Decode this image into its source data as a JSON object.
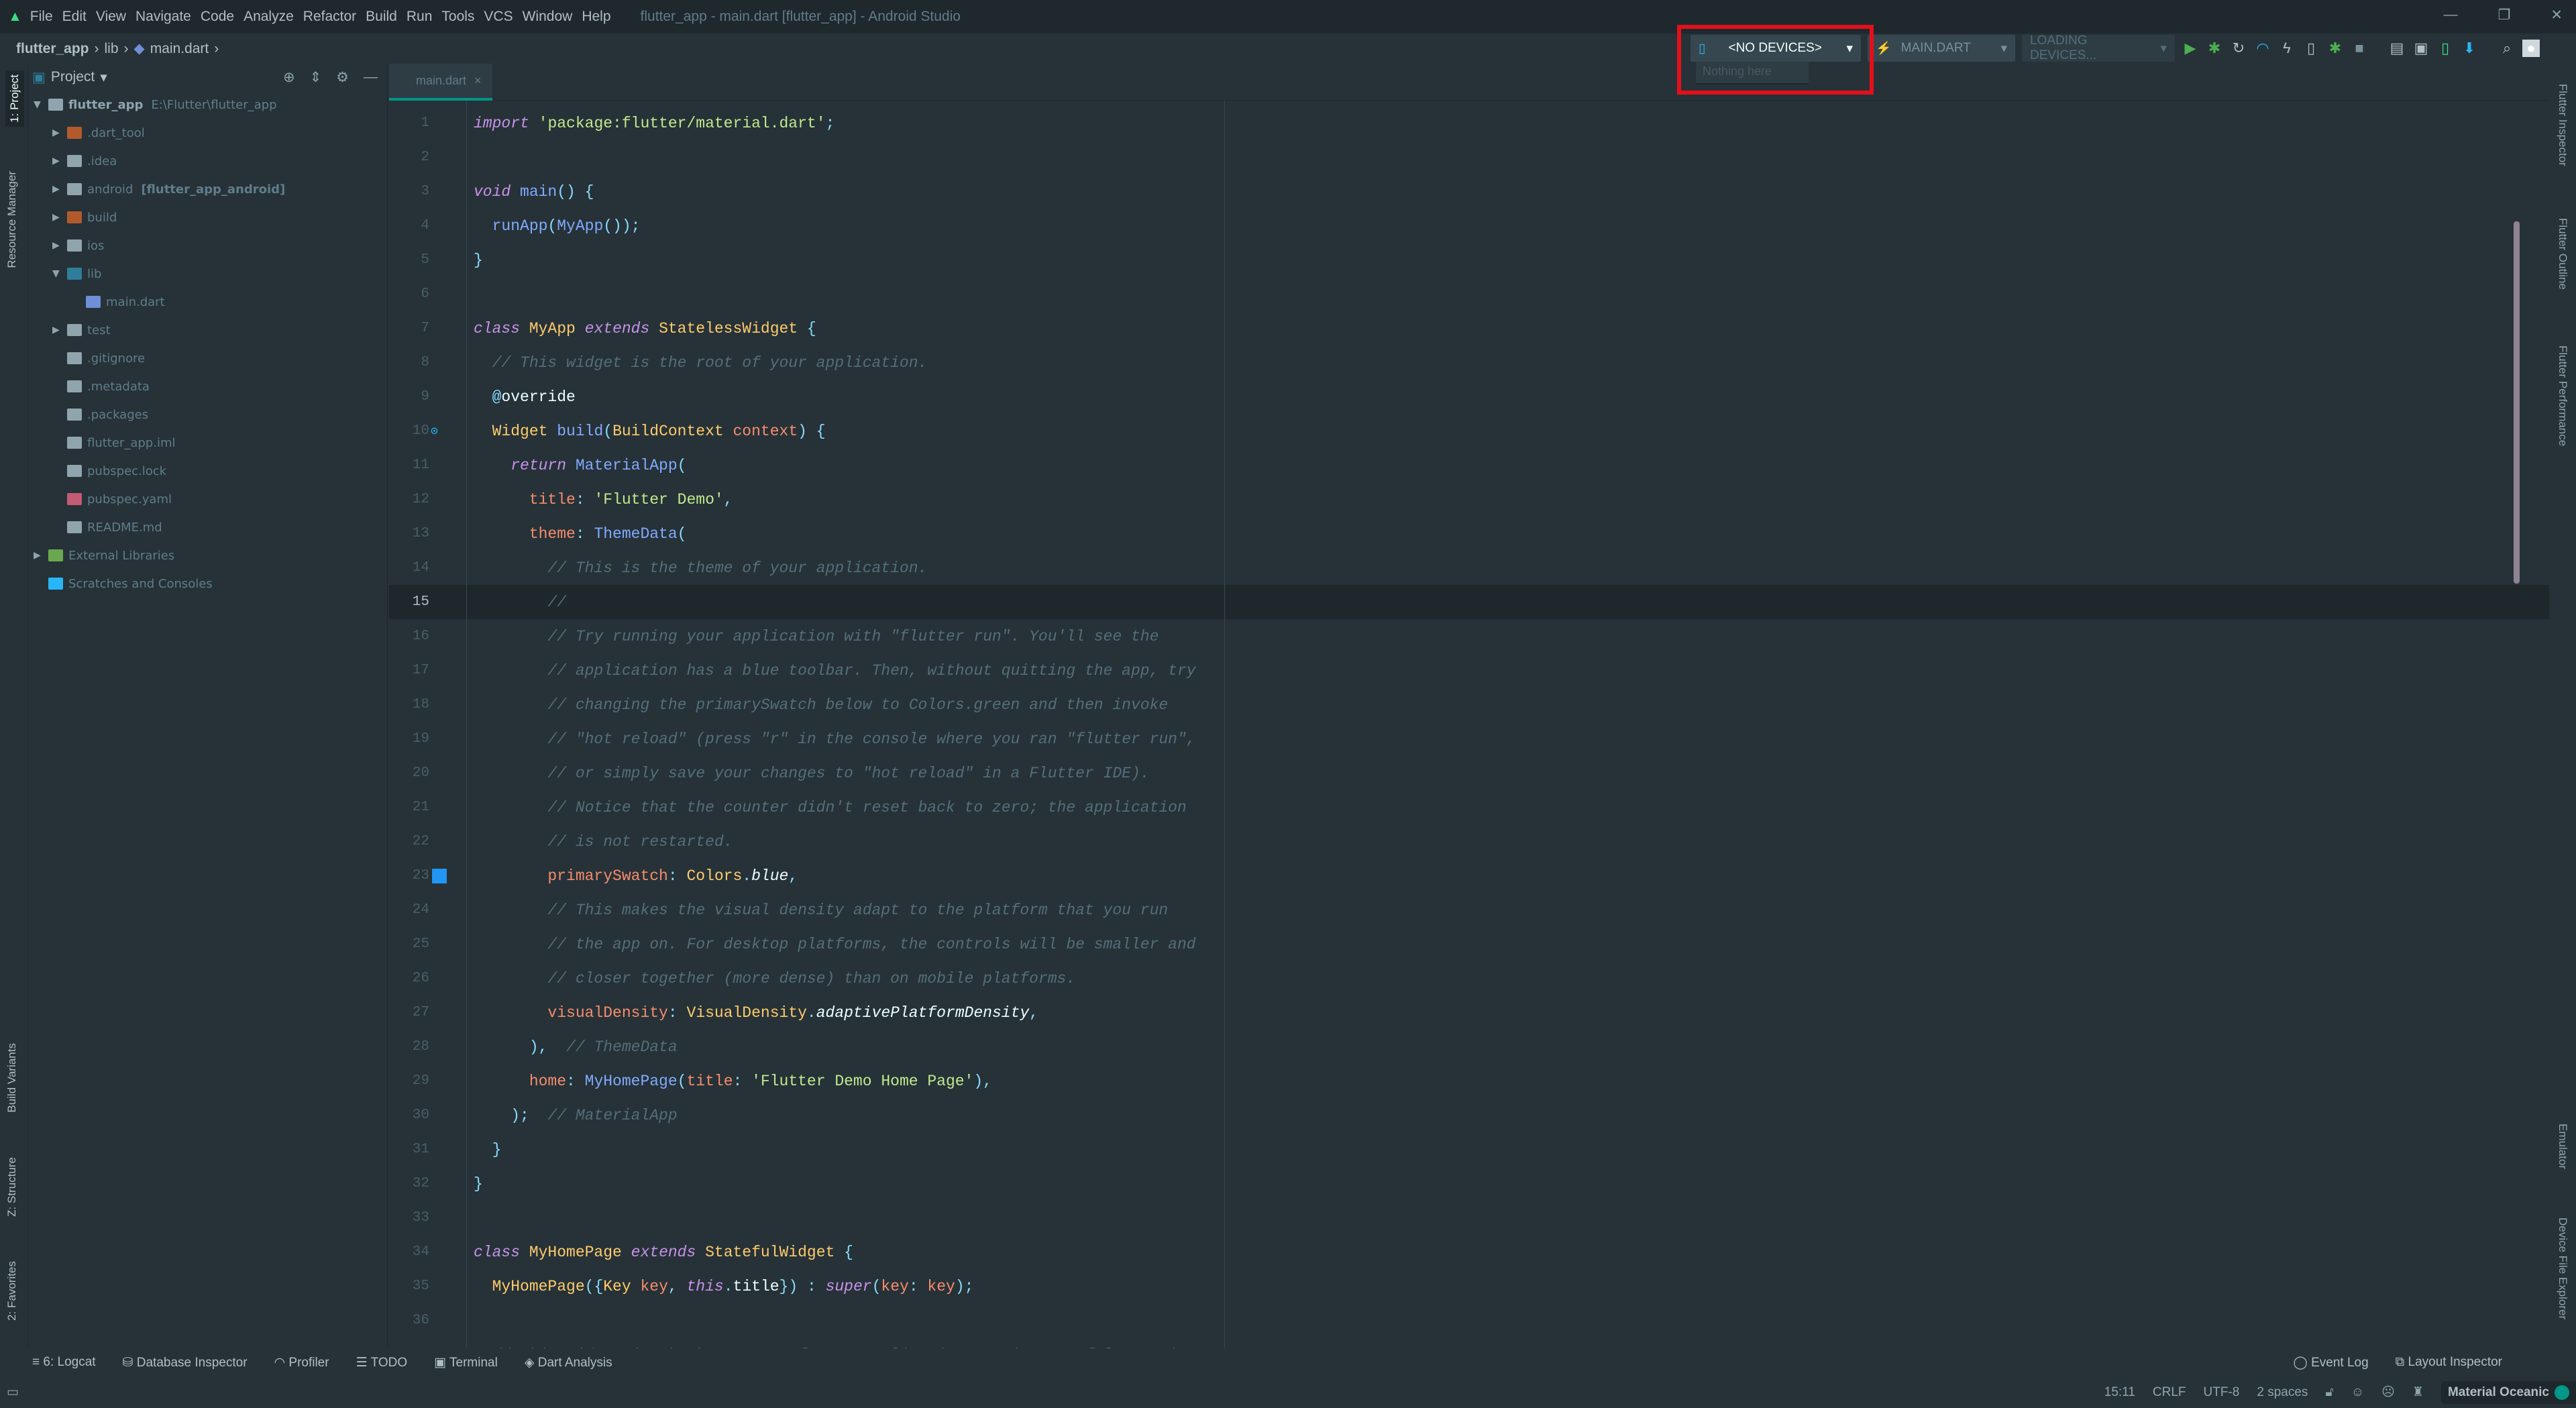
{
  "menu": {
    "items": [
      "File",
      "Edit",
      "View",
      "Navigate",
      "Code",
      "Analyze",
      "Refactor",
      "Build",
      "Run",
      "Tools",
      "VCS",
      "Window",
      "Help"
    ],
    "title": "flutter_app - main.dart [flutter_app] - Android Studio"
  },
  "breadcrumb": [
    "flutter_app",
    "lib",
    "main.dart"
  ],
  "toolbar": {
    "device": "<NO DEVICES>",
    "device_popup": "Nothing here",
    "config": "MAIN.DART",
    "loading": "LOADING DEVICES..."
  },
  "left_strip": [
    "1: Project",
    "Resource Manager",
    "Build Variants",
    "Z: Structure",
    "2: Favorites"
  ],
  "right_strip": [
    "Flutter Inspector",
    "Flutter Outline",
    "Flutter Performance",
    "Emulator",
    "Device File Explorer"
  ],
  "project": {
    "header": "Project",
    "tree": [
      {
        "label": "flutter_app",
        "extra": "E:\\Flutter\\flutter_app",
        "depth": 0,
        "arrow": "▼",
        "icon": "#90a4ae",
        "bold": true
      },
      {
        "label": ".dart_tool",
        "depth": 1,
        "arrow": "▶",
        "icon": "#b35a2d"
      },
      {
        "label": ".idea",
        "depth": 1,
        "arrow": "▶",
        "icon": "#90a4ae"
      },
      {
        "label": "android",
        "extra": "[flutter_app_android]",
        "depth": 1,
        "arrow": "▶",
        "icon": "#90a4ae"
      },
      {
        "label": "build",
        "depth": 1,
        "arrow": "▶",
        "icon": "#b35a2d"
      },
      {
        "label": "ios",
        "depth": 1,
        "arrow": "▶",
        "icon": "#90a4ae"
      },
      {
        "label": "lib",
        "depth": 1,
        "arrow": "▼",
        "icon": "#2e7d9b"
      },
      {
        "label": "main.dart",
        "depth": 2,
        "arrow": "",
        "icon": "#6f8fd6"
      },
      {
        "label": "test",
        "depth": 1,
        "arrow": "▶",
        "icon": "#90a4ae"
      },
      {
        "label": ".gitignore",
        "depth": 1,
        "arrow": "",
        "icon": "#90a4ae"
      },
      {
        "label": ".metadata",
        "depth": 1,
        "arrow": "",
        "icon": "#90a4ae"
      },
      {
        "label": ".packages",
        "depth": 1,
        "arrow": "",
        "icon": "#90a4ae"
      },
      {
        "label": "flutter_app.iml",
        "depth": 1,
        "arrow": "",
        "icon": "#90a4ae"
      },
      {
        "label": "pubspec.lock",
        "depth": 1,
        "arrow": "",
        "icon": "#90a4ae"
      },
      {
        "label": "pubspec.yaml",
        "depth": 1,
        "arrow": "",
        "icon": "#c25b74"
      },
      {
        "label": "README.md",
        "depth": 1,
        "arrow": "",
        "icon": "#90a4ae"
      },
      {
        "label": "External Libraries",
        "depth": 0,
        "arrow": "▶",
        "icon": "#6aa84f"
      },
      {
        "label": "Scratches and Consoles",
        "depth": 0,
        "arrow": "",
        "icon": "#29b6f6"
      }
    ]
  },
  "editor": {
    "tab": "main.dart",
    "current_line": 15,
    "lines": [
      [
        [
          "import",
          "kw"
        ],
        [
          " ",
          "plain"
        ],
        [
          "'package:flutter/material.dart'",
          "str"
        ],
        [
          ";",
          "pun"
        ]
      ],
      [],
      [
        [
          "void",
          "kw"
        ],
        [
          " main",
          "fn"
        ],
        [
          "() {",
          "pun"
        ]
      ],
      [
        [
          "  runApp",
          "fn"
        ],
        [
          "(",
          "pun"
        ],
        [
          "MyApp",
          "fn"
        ],
        [
          "());",
          "pun"
        ]
      ],
      [
        [
          "}",
          "pun"
        ]
      ],
      [],
      [
        [
          "class",
          "kw"
        ],
        [
          " MyApp ",
          "cls"
        ],
        [
          "extends",
          "kw"
        ],
        [
          " StatelessWidget ",
          "cls"
        ],
        [
          "{",
          "pun"
        ]
      ],
      [
        [
          "  // This widget is the root of your application.",
          "cmt"
        ]
      ],
      [
        [
          "  @",
          "pun"
        ],
        [
          "override",
          "plain"
        ]
      ],
      [
        [
          "  Widget ",
          "cls"
        ],
        [
          "build",
          "fn"
        ],
        [
          "(",
          "pun"
        ],
        [
          "BuildContext ",
          "cls"
        ],
        [
          "context",
          "prm"
        ],
        [
          ") {",
          "pun"
        ]
      ],
      [
        [
          "    return",
          "kw"
        ],
        [
          " MaterialApp",
          "fn"
        ],
        [
          "(",
          "pun"
        ]
      ],
      [
        [
          "      title",
          "prm"
        ],
        [
          ": ",
          "pun"
        ],
        [
          "'Flutter Demo'",
          "str"
        ],
        [
          ",",
          "pun"
        ]
      ],
      [
        [
          "      theme",
          "prm"
        ],
        [
          ": ",
          "pun"
        ],
        [
          "ThemeData",
          "fn"
        ],
        [
          "(",
          "pun"
        ]
      ],
      [
        [
          "        // This is the theme of your application.",
          "cmt"
        ]
      ],
      [
        [
          "        //",
          "cmt"
        ]
      ],
      [
        [
          "        // Try running your application with \"flutter run\". You'll see the",
          "cmt"
        ]
      ],
      [
        [
          "        // application has a blue toolbar. Then, without quitting the app, try",
          "cmt"
        ]
      ],
      [
        [
          "        // changing the primarySwatch below to Colors.green and then invoke",
          "cmt"
        ]
      ],
      [
        [
          "        // \"hot reload\" (press \"r\" in the console where you ran \"flutter run\",",
          "cmt"
        ]
      ],
      [
        [
          "        // or simply save your changes to \"hot reload\" in a Flutter IDE).",
          "cmt"
        ]
      ],
      [
        [
          "        // Notice that the counter didn't reset back to zero; the application",
          "cmt"
        ]
      ],
      [
        [
          "        // is not restarted.",
          "cmt"
        ]
      ],
      [
        [
          "        primarySwatch",
          "prm"
        ],
        [
          ": ",
          "pun"
        ],
        [
          "Colors",
          "cls"
        ],
        [
          ".",
          "pun"
        ],
        [
          "blue",
          "it"
        ],
        [
          ",",
          "pun"
        ]
      ],
      [
        [
          "        // This makes the visual density adapt to the platform that you run",
          "cmt"
        ]
      ],
      [
        [
          "        // the app on. For desktop platforms, the controls will be smaller and",
          "cmt"
        ]
      ],
      [
        [
          "        // closer together (more dense) than on mobile platforms.",
          "cmt"
        ]
      ],
      [
        [
          "        visualDensity",
          "prm"
        ],
        [
          ": ",
          "pun"
        ],
        [
          "VisualDensity",
          "cls"
        ],
        [
          ".",
          "pun"
        ],
        [
          "adaptivePlatformDensity",
          "it"
        ],
        [
          ",",
          "pun"
        ]
      ],
      [
        [
          "      ),  ",
          "pun"
        ],
        [
          "// ThemeData",
          "cmt"
        ]
      ],
      [
        [
          "      home",
          "prm"
        ],
        [
          ": ",
          "pun"
        ],
        [
          "MyHomePage",
          "fn"
        ],
        [
          "(",
          "pun"
        ],
        [
          "title",
          "prm"
        ],
        [
          ": ",
          "pun"
        ],
        [
          "'Flutter Demo Home Page'",
          "str"
        ],
        [
          "),",
          "pun"
        ]
      ],
      [
        [
          "    );  ",
          "pun"
        ],
        [
          "// MaterialApp",
          "cmt"
        ]
      ],
      [
        [
          "  }",
          "pun"
        ]
      ],
      [
        [
          "}",
          "pun"
        ]
      ],
      [],
      [
        [
          "class",
          "kw"
        ],
        [
          " MyHomePage ",
          "cls"
        ],
        [
          "extends",
          "kw"
        ],
        [
          " StatefulWidget ",
          "cls"
        ],
        [
          "{",
          "pun"
        ]
      ],
      [
        [
          "  MyHomePage",
          "cls"
        ],
        [
          "({",
          "pun"
        ],
        [
          "Key ",
          "cls"
        ],
        [
          "key",
          "prm"
        ],
        [
          ", ",
          "pun"
        ],
        [
          "this",
          "kw"
        ],
        [
          ".",
          "pun"
        ],
        [
          "title",
          "plain"
        ],
        [
          "}) : ",
          "pun"
        ],
        [
          "super",
          "kw"
        ],
        [
          "(",
          "pun"
        ],
        [
          "key",
          "prm"
        ],
        [
          ": ",
          "pun"
        ],
        [
          "key",
          "prm"
        ],
        [
          ");",
          "pun"
        ]
      ],
      [],
      [
        [
          "  // This widget is the home page of your application. It is stateful, meaning",
          "cmt"
        ]
      ]
    ]
  },
  "bottom_tools": {
    "left": [
      "6: Logcat",
      "Database Inspector",
      "Profiler",
      "TODO",
      "Terminal",
      "Dart Analysis"
    ],
    "right": [
      "Event Log",
      "Layout Inspector"
    ]
  },
  "status": {
    "position": "15:11",
    "line_sep": "CRLF",
    "encoding": "UTF-8",
    "indent": "2 spaces",
    "theme": "Material Oceanic"
  }
}
